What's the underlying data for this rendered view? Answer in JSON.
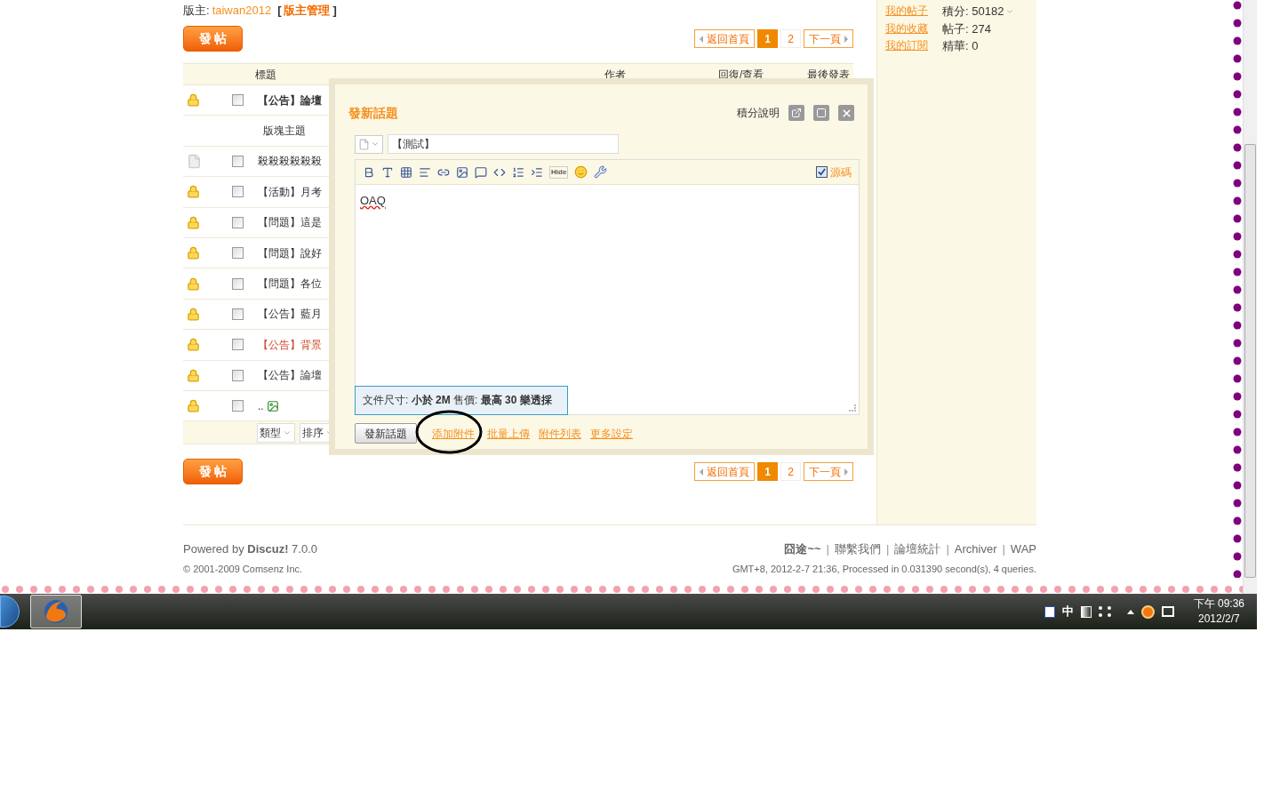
{
  "moderator": {
    "label": "版主:",
    "name": "taiwan2012",
    "bracket_open": "[",
    "manage": "版主管理",
    "bracket_close": "]"
  },
  "top_bar": {
    "post_button": "發 帖",
    "pagination": {
      "first": "返回首頁",
      "pages": [
        {
          "label": "1",
          "selected": true
        },
        {
          "label": "2",
          "selected": false
        }
      ],
      "next": "下一頁"
    }
  },
  "table": {
    "columns": [
      "標題",
      "作者",
      "回復/查看",
      "最後發表"
    ],
    "rows": [
      {
        "kind": "locked",
        "title": "【公告】論壇",
        "bold": true,
        "highlight": false,
        "checked": false
      },
      {
        "kind": "separator",
        "title": "版塊主題",
        "bold": false,
        "highlight": false
      },
      {
        "kind": "normal",
        "title": "殺殺殺殺殺殺",
        "bold": false,
        "highlight": false,
        "checked": false
      },
      {
        "kind": "locked",
        "title": "【活動】月考",
        "bold": false,
        "highlight": false,
        "checked": false
      },
      {
        "kind": "locked",
        "title": "【問題】這是",
        "bold": false,
        "highlight": false,
        "checked": false
      },
      {
        "kind": "locked",
        "title": "【問題】說好",
        "bold": false,
        "highlight": false,
        "checked": false
      },
      {
        "kind": "locked",
        "title": "【問題】各位",
        "bold": false,
        "highlight": false,
        "checked": false
      },
      {
        "kind": "locked",
        "title": "【公告】藍月",
        "bold": false,
        "highlight": false,
        "checked": false
      },
      {
        "kind": "locked",
        "title": "【公告】背景",
        "bold": false,
        "highlight": true,
        "checked": false
      },
      {
        "kind": "locked",
        "title": "【公告】論壇",
        "bold": false,
        "highlight": false,
        "checked": false
      },
      {
        "kind": "locked",
        "title": "..",
        "bold": false,
        "highlight": false,
        "checked": false,
        "image": true
      }
    ],
    "filters": [
      "類型",
      "排序"
    ]
  },
  "dialog": {
    "title": "發新話題",
    "help": "積分說明",
    "subject": "【測試】",
    "source_mode": {
      "label": "源碼",
      "checked": true
    },
    "hide_label": "Hide",
    "body": "OAQ",
    "tooltip": "文件尺寸: **小於 2M**  售價: **最高 30 樂透採**",
    "submit": "發新話題",
    "links": [
      "添加附件",
      "批量上傳",
      "附件列表",
      "更多設定"
    ]
  },
  "bottom_bar": {
    "post_button": "發 帖",
    "pagination": {
      "first": "返回首頁",
      "pages": [
        {
          "label": "1",
          "selected": true
        },
        {
          "label": "2",
          "selected": false
        }
      ],
      "next": "下一頁"
    }
  },
  "sidebar": {
    "links": [
      "我的帖子",
      "我的收藏",
      "我的訂閱"
    ],
    "stats": [
      "積分: 50182",
      "帖子: 274",
      "精華: 0"
    ]
  },
  "footer": {
    "powered": "Powered by **Discuz!** 7.0.0",
    "copyright": "© 2001-2009 Comsenz Inc.",
    "links": [
      {
        "label": "囧途~~",
        "bold": true
      },
      {
        "label": "聯繫我們",
        "bold": false,
        "separator": "|"
      },
      {
        "label": "論壇統計",
        "bold": false,
        "separator": "|"
      },
      {
        "label": "Archiver",
        "bold": false,
        "separator": "|"
      },
      {
        "label": "WAP",
        "bold": false,
        "separator": "|"
      }
    ],
    "stats": "GMT+8, 2012-2-7 21:36, Processed in 0.031390 second(s), 4 queries."
  },
  "taskbar": {
    "ime": "中",
    "time": "下午 09:36",
    "date": "2012/2/7"
  }
}
